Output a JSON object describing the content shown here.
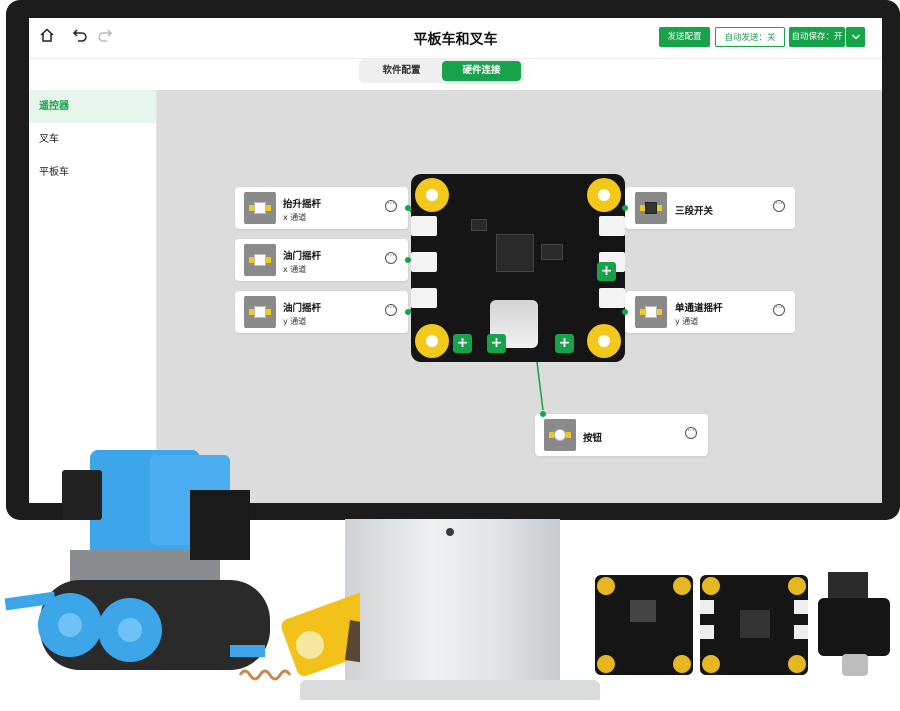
{
  "header": {
    "title": "平板车和叉车",
    "send_config": "发送配置",
    "auto_send": "自动发送：关",
    "auto_save": "自动保存：开"
  },
  "tabs": [
    {
      "label": "软件配置",
      "active": false
    },
    {
      "label": "硬件连接",
      "active": true
    }
  ],
  "sidebar": {
    "items": [
      {
        "label": "遥控器",
        "active": true
      },
      {
        "label": "叉车",
        "active": false
      },
      {
        "label": "平板车",
        "active": false
      }
    ]
  },
  "modules": [
    {
      "name": "抬升摇杆",
      "channel": "x 通道"
    },
    {
      "name": "油门摇杆",
      "channel": "x 通道"
    },
    {
      "name": "油门摇杆",
      "channel": "y 通道"
    },
    {
      "name": "三段开关",
      "channel": ""
    },
    {
      "name": "单通道摇杆",
      "channel": "y 通道"
    },
    {
      "name": "按钮",
      "channel": ""
    }
  ],
  "colors": {
    "accent": "#16a34a",
    "canvas": "#dcdcdc",
    "port_hole": "#f2c81a"
  },
  "icons": [
    "home-icon",
    "undo-icon",
    "redo-icon",
    "chevron-down-icon",
    "more-icon",
    "plus-icon"
  ]
}
